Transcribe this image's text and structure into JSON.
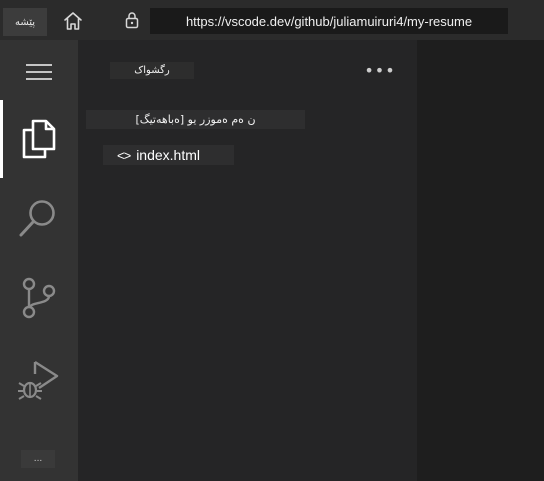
{
  "browser": {
    "tab_label": "پێشه",
    "address": "https://vscode.dev/github/juliamuiruri4/my-resume",
    "icons": [
      "home-icon",
      "lock-icon"
    ]
  },
  "activity_bar": {
    "items": [
      {
        "name": "menu",
        "icon": "hamburger-menu-icon"
      },
      {
        "name": "explorer",
        "icon": "files-icon",
        "active": true
      },
      {
        "name": "search",
        "icon": "search-icon"
      },
      {
        "name": "source-control",
        "icon": "source-control-icon"
      },
      {
        "name": "run-and-debug",
        "icon": "run-debug-icon"
      }
    ],
    "more_label": "..."
  },
  "sidebar": {
    "title": "رگشواک",
    "more_actions_label": "•••",
    "section_header": "[ەباهەتیگ] ن ەم ەموزر یو",
    "files": [
      {
        "icon": "<>",
        "name": "index.html"
      }
    ]
  },
  "colors": {
    "activity_bar_bg": "#333333",
    "sidebar_bg": "#252526",
    "editor_bg": "#1e1e1e",
    "browser_bar_bg": "#2b2b2b",
    "active_indicator": "#ffffff"
  }
}
